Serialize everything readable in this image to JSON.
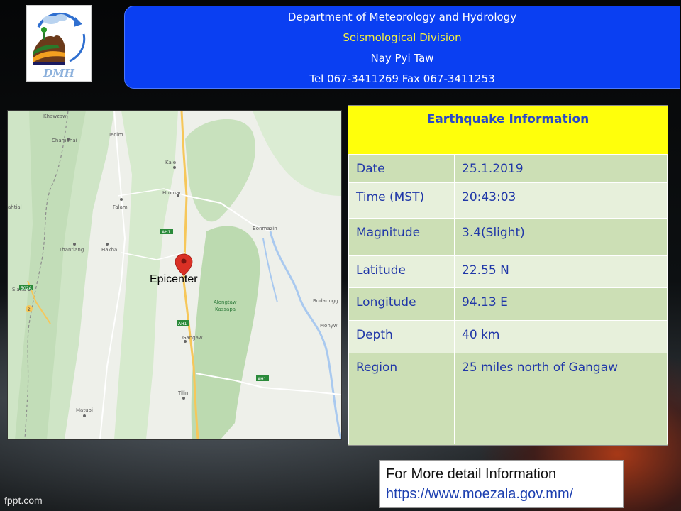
{
  "logo": {
    "text": "DMH"
  },
  "header": {
    "department": "Department of Meteorology and Hydrology",
    "division": "Seismological Division",
    "city": "Nay Pyi Taw",
    "contact": "Tel 067-3411269 Fax 067-3411253"
  },
  "map": {
    "epicenter_label": "Epicenter",
    "places": [
      "Khawzawl",
      "Champhai",
      "Tedim",
      "Kale",
      "Htomar",
      "Falam",
      "Thantlang",
      "Hakha",
      "Bonmazin",
      "Siaha",
      "Alongtaw",
      "Kassapa",
      "Budaungg",
      "Monyw",
      "Gangaw",
      "Tilin",
      "Matupi",
      "ahtial"
    ],
    "road_labels": [
      "AH1",
      "502A",
      "2"
    ],
    "icons": [
      "epicenter-pin-icon"
    ]
  },
  "info": {
    "title": "Earthquake Information",
    "rows": [
      {
        "label": "Date",
        "value": "25.1.2019"
      },
      {
        "label": "Time (MST)",
        "value": "20:43:03"
      },
      {
        "label": "Magnitude",
        "value": "3.4(Slight)"
      },
      {
        "label": "Latitude",
        "value": "22.55 N"
      },
      {
        "label": "Longitude",
        "value": "94.13 E"
      },
      {
        "label": "Depth",
        "value": "40 km"
      },
      {
        "label": "Region",
        "value": "25 miles north of Gangaw"
      }
    ]
  },
  "more": {
    "text": "For More detail Information",
    "url": "https://www.moezala.gov.mm/"
  },
  "footer": {
    "text": "fppt.com"
  },
  "colors": {
    "header_bg": "#0a3ff2",
    "division_text": "#f5f040",
    "info_title_bg": "#ffff0b",
    "table_text": "#2037a8",
    "pin": "#d93025"
  }
}
